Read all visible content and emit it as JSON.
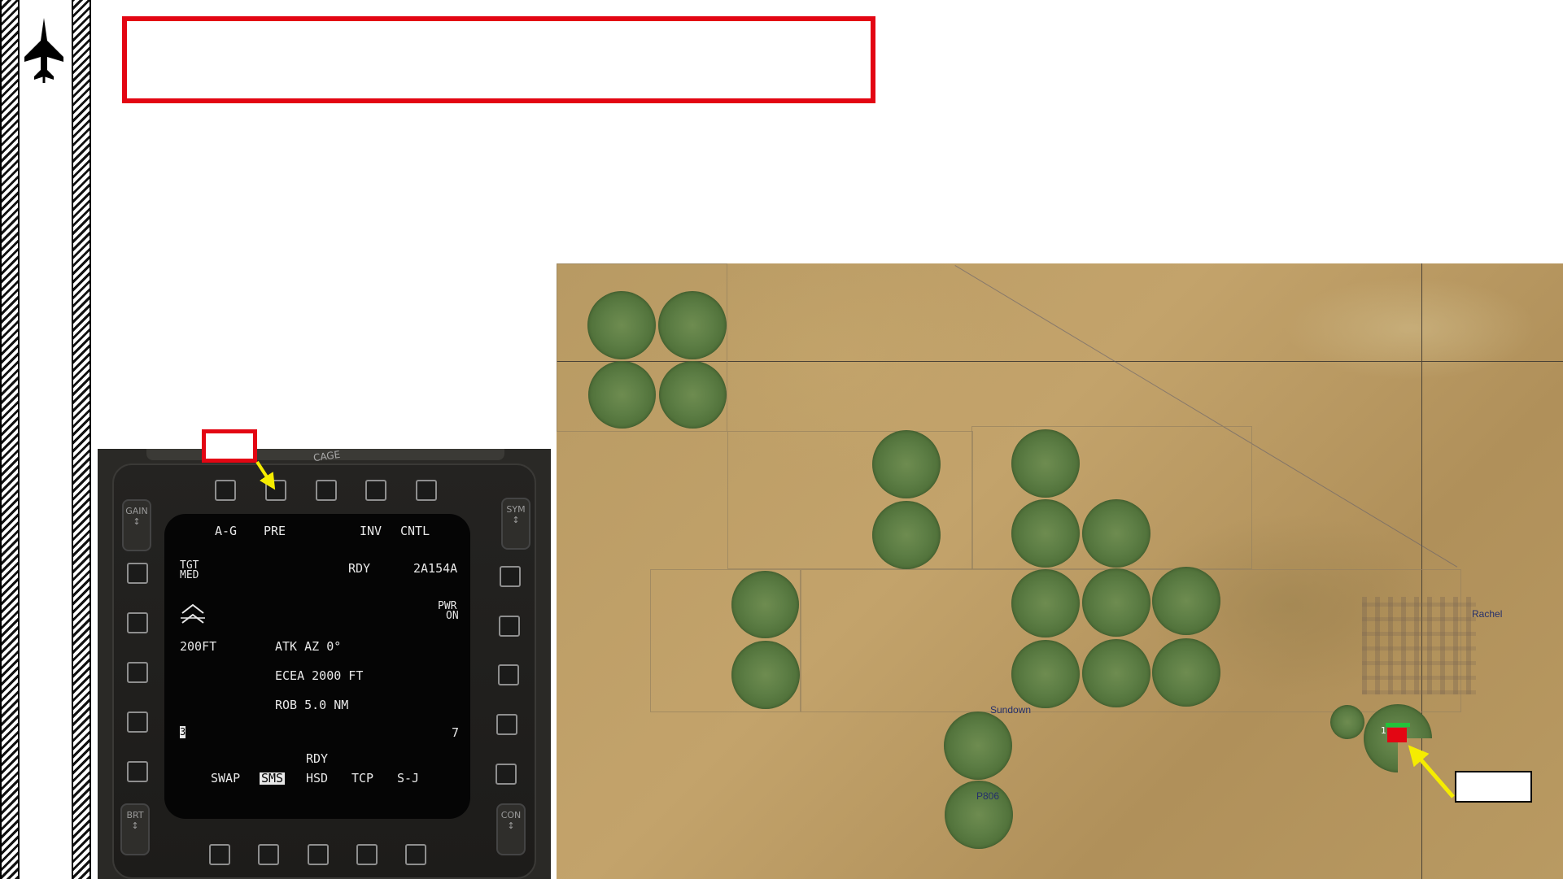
{
  "mfd": {
    "cage_label": "CAGE",
    "left_rockers": {
      "gain": "GAIN",
      "brt": "BRT"
    },
    "right_rockers": {
      "sym": "SYM",
      "con": "CON"
    },
    "top_labels": [
      "A-G",
      "PRE",
      "INV",
      "CNTL"
    ],
    "tgt_med_line1": "TGT",
    "tgt_med_line2": "MED",
    "rdy_top": "RDY",
    "weapon_code": "2A154A",
    "pwr_line1": "PWR",
    "pwr_line2": "ON",
    "altitude": "200FT",
    "atk_az": "ATK AZ 0°",
    "ecea": "ECEA 2000 FT",
    "rob": "ROB 5.0 NM",
    "station_left": "3",
    "station_right": "7",
    "rdy_bottom": "RDY",
    "bottom_labels": [
      "SWAP",
      "SMS",
      "HSD",
      "TCP",
      "S-J"
    ]
  },
  "map": {
    "towns": [
      "Rachel",
      "Sundown",
      "P806"
    ],
    "marker_number": "1",
    "colors": {
      "field_green": "#5d7e45",
      "desert": "#b89a63",
      "marker_red": "#e30613",
      "marker_green": "#22c33a",
      "arrow_yellow": "#f5ec00"
    }
  },
  "colors": {
    "callout_red": "#e30613",
    "arrow_yellow": "#f5ec00"
  }
}
